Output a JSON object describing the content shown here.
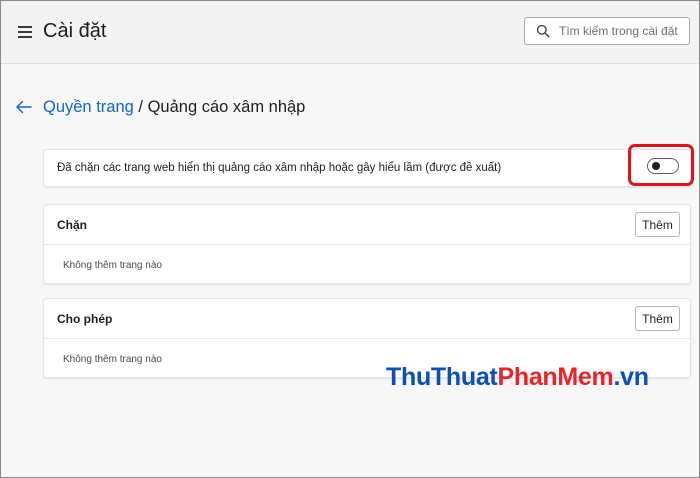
{
  "header": {
    "title": "Cài đặt",
    "search_placeholder": "Tìm kiếm trong cài đặt"
  },
  "breadcrumb": {
    "parent": "Quyền trang",
    "separator": " / ",
    "current": "Quảng cáo xâm nhập"
  },
  "toggle_setting": {
    "label": "Đã chặn các trang web hiển thị quảng cáo xâm nhập hoặc gây hiểu lầm (được đề xuất)",
    "enabled": false,
    "highlight_color": "#e0121b"
  },
  "block_section": {
    "title": "Chặn",
    "add_label": "Thêm",
    "empty_text": "Không thêm trang nào"
  },
  "allow_section": {
    "title": "Cho phép",
    "add_label": "Thêm",
    "empty_text": "Không thêm trang nào"
  },
  "watermark": {
    "part1": "ThuThuat",
    "part2": "PhanMem",
    "part3": ".vn",
    "color_primary": "#0d4fb5",
    "color_accent": "#e8232a"
  },
  "colors": {
    "link": "#1166c4",
    "header_bg": "#f3f3f3",
    "page_bg": "#f7f7f7"
  },
  "icons": {
    "menu": "menu-icon",
    "search": "search-icon",
    "back": "back-arrow-icon"
  }
}
